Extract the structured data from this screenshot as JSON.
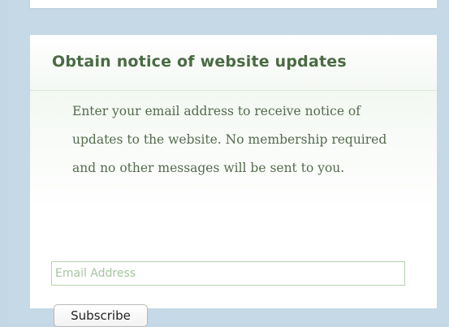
{
  "widget": {
    "title": "Obtain notice of website updates",
    "description": "Enter your email address to receive notice of updates to the website. No membership required and no other messages will be sent to you.",
    "email_placeholder": "Email Address",
    "subscribe_label": "Subscribe"
  },
  "colors": {
    "page_background": "#c3d7e4",
    "title_text": "#4a6a44",
    "body_text": "#556b4e",
    "input_border": "#b7d1b1"
  }
}
